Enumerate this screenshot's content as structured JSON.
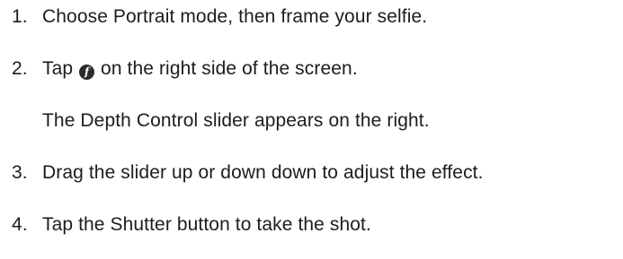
{
  "steps": [
    {
      "number": "1.",
      "text": "Choose Portrait mode, then frame your selfie."
    },
    {
      "number": "2.",
      "text_before": "Tap",
      "icon_glyph": "f",
      "icon_name": "depth-control-icon",
      "text_after": "on the right side of the screen.",
      "note": "The Depth Control slider appears on the right."
    },
    {
      "number": "3.",
      "text": "Drag the slider up or down down to adjust the effect."
    },
    {
      "number": "4.",
      "text": "Tap the Shutter button to take the shot."
    }
  ]
}
